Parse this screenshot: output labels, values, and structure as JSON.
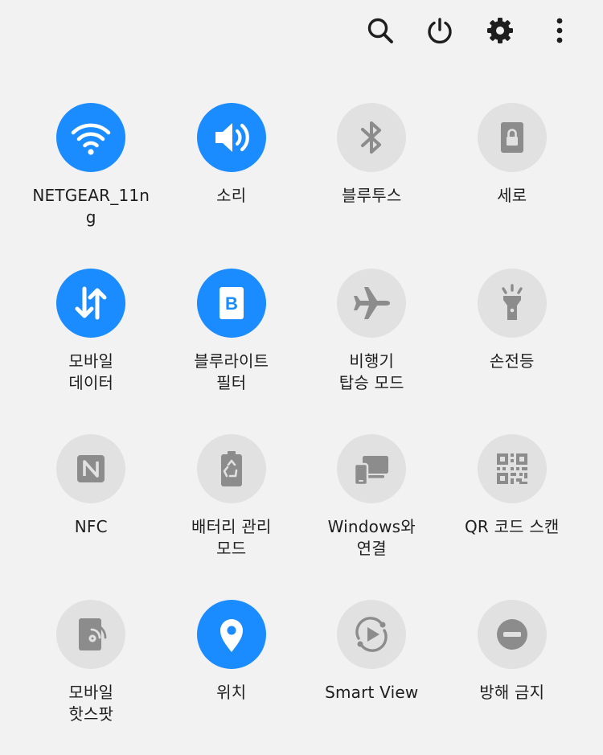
{
  "top_bar": {
    "icons": [
      "search-icon",
      "power-icon",
      "settings-icon",
      "more-options-icon"
    ]
  },
  "colors": {
    "active": "#1a8cff",
    "inactive": "#e1e1e1",
    "inactive_icon": "#8c8c8c",
    "background": "#f2f2f2"
  },
  "tiles": [
    {
      "label_lines": [
        "NETGEAR_11n",
        "g"
      ],
      "active": true,
      "icon": "wifi-icon"
    },
    {
      "label_lines": [
        "소리",
        ""
      ],
      "active": true,
      "icon": "sound-icon"
    },
    {
      "label_lines": [
        "블루투스",
        ""
      ],
      "active": false,
      "icon": "bluetooth-icon"
    },
    {
      "label_lines": [
        "세로",
        ""
      ],
      "active": false,
      "icon": "portrait-lock-icon"
    },
    {
      "label_lines": [
        "모바일",
        "데이터"
      ],
      "active": true,
      "icon": "mobile-data-icon"
    },
    {
      "label_lines": [
        "블루라이트",
        "필터"
      ],
      "active": true,
      "icon": "blue-light-filter-icon"
    },
    {
      "label_lines": [
        "비행기",
        "탑승 모드"
      ],
      "active": false,
      "icon": "airplane-icon"
    },
    {
      "label_lines": [
        "손전등",
        ""
      ],
      "active": false,
      "icon": "flashlight-icon"
    },
    {
      "label_lines": [
        "NFC",
        ""
      ],
      "active": false,
      "icon": "nfc-icon"
    },
    {
      "label_lines": [
        "배터리 관리",
        "모드"
      ],
      "active": false,
      "icon": "battery-saver-icon"
    },
    {
      "label_lines": [
        "Windows와",
        "연결"
      ],
      "active": false,
      "icon": "link-to-windows-icon"
    },
    {
      "label_lines": [
        "QR 코드 스캔",
        ""
      ],
      "active": false,
      "icon": "qr-code-icon"
    },
    {
      "label_lines": [
        "모바일",
        "핫스팟"
      ],
      "active": false,
      "icon": "hotspot-icon"
    },
    {
      "label_lines": [
        "위치",
        ""
      ],
      "active": true,
      "icon": "location-icon"
    },
    {
      "label_lines": [
        "Smart View",
        ""
      ],
      "active": false,
      "icon": "smart-view-icon"
    },
    {
      "label_lines": [
        "방해 금지",
        ""
      ],
      "active": false,
      "icon": "do-not-disturb-icon"
    }
  ]
}
